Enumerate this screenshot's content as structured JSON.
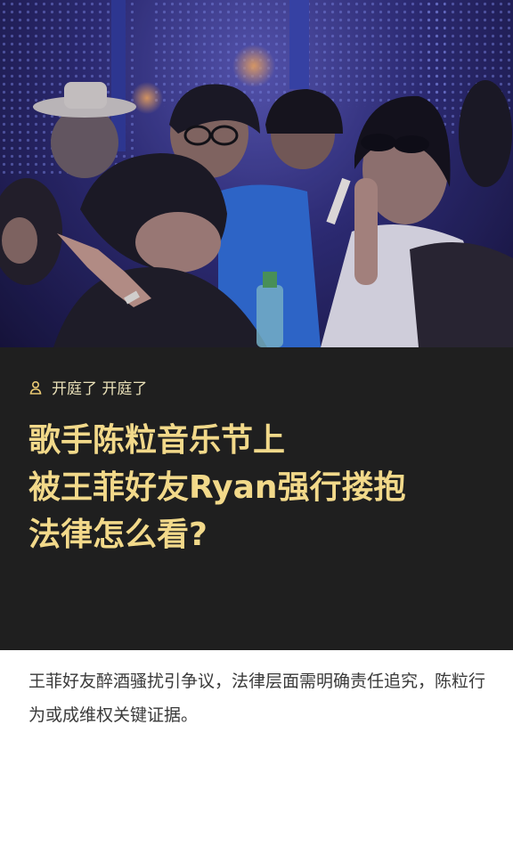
{
  "author": {
    "name": "开庭了 开庭了",
    "icon": "user-icon"
  },
  "headline": {
    "line1": "歌手陈粒音乐节上",
    "line2": "被王菲好友Ryan强行搂抱",
    "line3": "法律怎么看?"
  },
  "summary": "王菲好友醉酒骚扰引争议，法律层面需明确责任追究，陈粒行为或成维权关键证据。",
  "colors": {
    "card_bg": "#1f1f1f",
    "headline": "#f2d98a",
    "author": "#e9e0b8",
    "summary": "#3a3a3a"
  }
}
